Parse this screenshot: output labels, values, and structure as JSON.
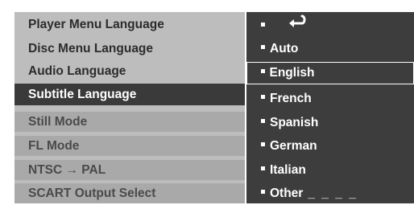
{
  "left_menu": {
    "items": [
      {
        "label": "Player Menu Language"
      },
      {
        "label": "Disc Menu Language"
      },
      {
        "label": "Audio Language"
      },
      {
        "label": "Subtitle Language"
      },
      {
        "label": "Still Mode"
      },
      {
        "label": "FL Mode"
      },
      {
        "label": "NTSC → PAL"
      },
      {
        "label": "SCART Output Select"
      }
    ],
    "selected_index": 3
  },
  "right_menu": {
    "return_icon": "return-arrow-icon",
    "items": [
      {
        "label": "Auto"
      },
      {
        "label": "English"
      },
      {
        "label": "French"
      },
      {
        "label": "Spanish"
      },
      {
        "label": "German"
      },
      {
        "label": "Italian"
      },
      {
        "label": "Other"
      }
    ],
    "other_blank": "_ _ _ _",
    "highlighted_index": 1
  },
  "colors": {
    "left_background": "#bdbdbd",
    "left_shaded": "#a9a9a9",
    "selected_background": "#3a3a3a",
    "right_background": "#3d3d3d",
    "text_light": "#ffffff",
    "text_dark": "#2c2c2c"
  }
}
